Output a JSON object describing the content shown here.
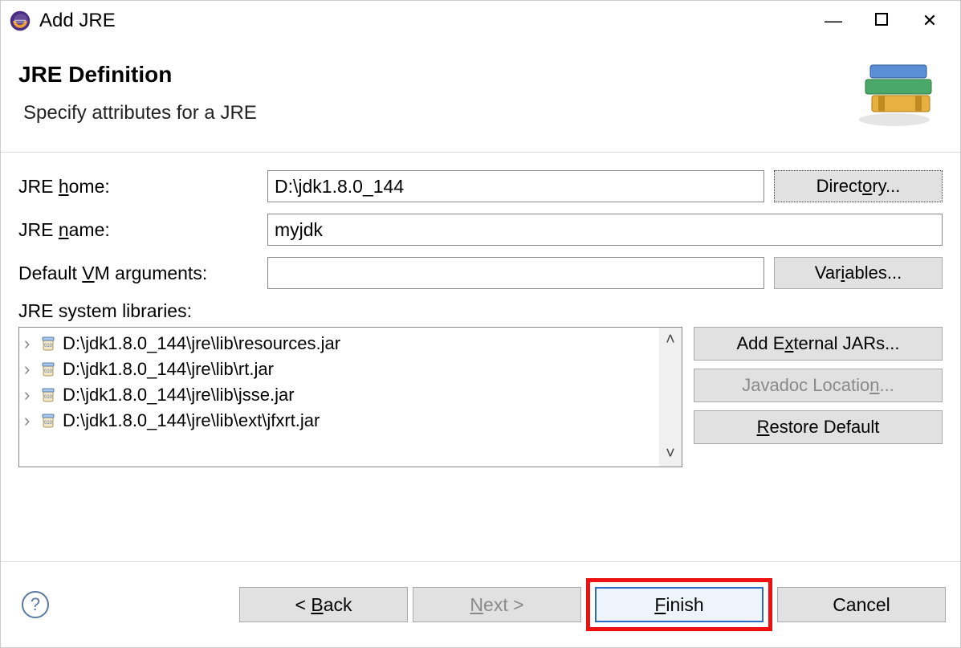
{
  "window": {
    "title": "Add JRE"
  },
  "header": {
    "title": "JRE Definition",
    "subtitle": "Specify attributes for a JRE"
  },
  "form": {
    "jre_home_label_pre": "JRE ",
    "jre_home_label_u": "h",
    "jre_home_label_post": "ome:",
    "jre_home_value": "D:\\jdk1.8.0_144",
    "directory_btn_pre": "Direct",
    "directory_btn_u": "o",
    "directory_btn_post": "ry...",
    "jre_name_label_pre": "JRE ",
    "jre_name_label_u": "n",
    "jre_name_label_post": "ame:",
    "jre_name_value": "myjdk",
    "vm_args_label_pre": "Default ",
    "vm_args_label_u": "V",
    "vm_args_label_post": "M arguments:",
    "vm_args_value": "",
    "variables_btn_pre": "Var",
    "variables_btn_u": "i",
    "variables_btn_post": "ables...",
    "lib_label": "JRE system libraries:"
  },
  "libs": [
    "D:\\jdk1.8.0_144\\jre\\lib\\resources.jar",
    "D:\\jdk1.8.0_144\\jre\\lib\\rt.jar",
    "D:\\jdk1.8.0_144\\jre\\lib\\jsse.jar",
    "D:\\jdk1.8.0_144\\jre\\lib\\ext\\jfxrt.jar"
  ],
  "sidebtns": {
    "add_ext_pre": "Add E",
    "add_ext_u": "x",
    "add_ext_post": "ternal JARs...",
    "javadoc_pre": "Javadoc Locatio",
    "javadoc_u": "n",
    "javadoc_post": "...",
    "restore_pre": "",
    "restore_u": "R",
    "restore_post": "estore Default"
  },
  "nav": {
    "back_pre": "< ",
    "back_u": "B",
    "back_post": "ack",
    "next_pre": "",
    "next_u": "N",
    "next_post": "ext >",
    "finish_pre": "",
    "finish_u": "F",
    "finish_post": "inish",
    "cancel": "Cancel"
  }
}
